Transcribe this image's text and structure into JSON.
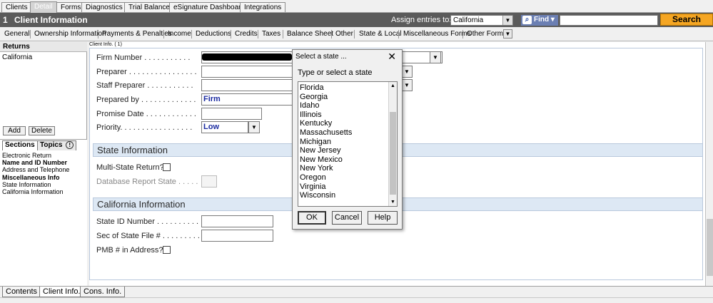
{
  "top_tabs": [
    "Clients",
    "Detail",
    "Forms",
    "Diagnostics",
    "Trial Balance",
    "eSignature Dashboard",
    "Integrations"
  ],
  "header": {
    "number": "1",
    "title": "Client Information",
    "assign_label": "Assign entries to:",
    "assign_value": "California",
    "find_label": "Find ▾",
    "search_label": "Search"
  },
  "sub_tabs": [
    "General",
    "Ownership Information",
    "Payments & Penalties",
    "Income",
    "Deductions",
    "Credits",
    "Taxes",
    "Balance Sheet",
    "Other",
    "State & Local",
    "Miscellaneous Forms",
    "Other Forms"
  ],
  "left": {
    "returns_header": "Returns",
    "returns_item": "California",
    "add_label": "Add",
    "delete_label": "Delete",
    "tab_sections": "Sections",
    "tab_topics": "Topics",
    "topics_badge": "!",
    "sections": [
      "Electronic Return",
      "Name and ID Number",
      "Address and Telephone",
      "Miscellaneous Info",
      "State Information",
      "California Information"
    ]
  },
  "main": {
    "frame_label": "Client Info. ( 1)",
    "fields": {
      "firm_number": "Firm Number . . . . . . . . . . .",
      "preparer": "Preparer . . . . . . . . . . . . . . . .",
      "staff_preparer": "Staff Preparer . . . . . . . . . . .",
      "prepared_by": "Prepared by . . . . . . . . . . . . .",
      "prepared_by_value": "Firm",
      "promise_date": "Promise Date . . . . . . . . . . . .",
      "priority": "Priority. . . . . . . . . . . . . . . . .",
      "priority_value": "Low"
    },
    "state_section": {
      "title": "State Information",
      "multi_state": "Multi-State Return?",
      "database_report": "Database Report State . . . . ."
    },
    "california_section": {
      "title": "California Information",
      "state_id": "State ID Number . . . . . . . . . .",
      "sec_of_state": "Sec of State File # . . . . . . . . .",
      "pmb": "PMB # in Address?"
    }
  },
  "bottom_tabs": [
    "Contents",
    "Client Info.",
    "Cons. Info."
  ],
  "dialog": {
    "title": "Select a state ...",
    "close": "✕",
    "prompt": "Type or select a state",
    "states": [
      "Florida",
      "Georgia",
      "Idaho",
      "Illinois",
      "Kentucky",
      "Massachusetts",
      "Michigan",
      "New Jersey",
      "New Mexico",
      "New York",
      "Oregon",
      "Virginia",
      "Wisconsin"
    ],
    "ok": "OK",
    "cancel": "Cancel",
    "help": "Help"
  }
}
